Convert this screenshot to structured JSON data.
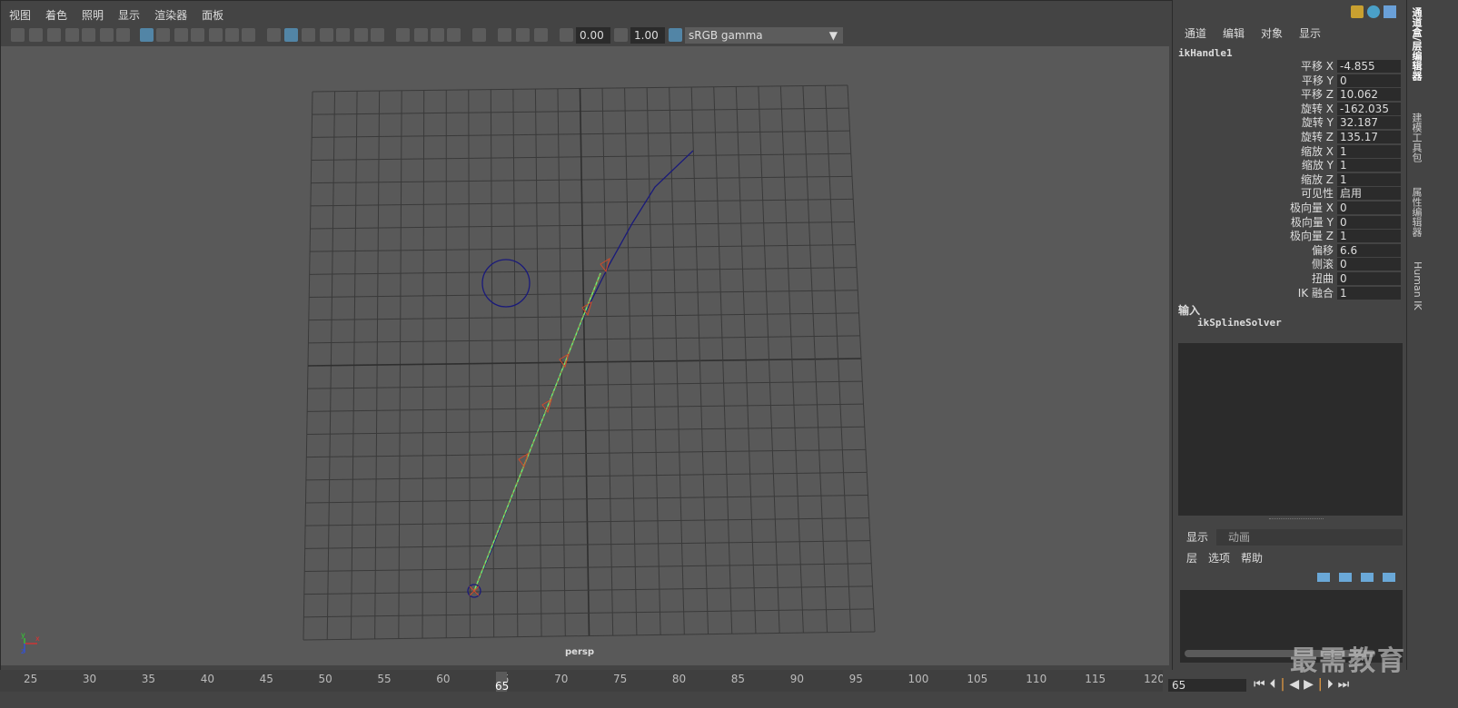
{
  "menubar": [
    "视图",
    "着色",
    "照明",
    "显示",
    "渲染器",
    "面板"
  ],
  "toolbar": {
    "exposure_value": "0.00",
    "gamma_value": "1.00",
    "colorspace": "sRGB gamma"
  },
  "viewport": {
    "camera_label": "persp",
    "axis_x": "x",
    "axis_y": "y",
    "axis_z": "z"
  },
  "channel_box": {
    "menu": [
      "通道",
      "编辑",
      "对象",
      "显示"
    ],
    "object_name": "ikHandle1",
    "attributes": [
      {
        "label": "平移 X",
        "value": "-4.855"
      },
      {
        "label": "平移 Y",
        "value": "0"
      },
      {
        "label": "平移 Z",
        "value": "10.062"
      },
      {
        "label": "旋转 X",
        "value": "-162.035"
      },
      {
        "label": "旋转 Y",
        "value": "32.187"
      },
      {
        "label": "旋转 Z",
        "value": "135.17"
      },
      {
        "label": "缩放 X",
        "value": "1"
      },
      {
        "label": "缩放 Y",
        "value": "1"
      },
      {
        "label": "缩放 Z",
        "value": "1"
      },
      {
        "label": "可见性",
        "value": "启用"
      },
      {
        "label": "极向量 X",
        "value": "0"
      },
      {
        "label": "极向量 Y",
        "value": "0"
      },
      {
        "label": "极向量 Z",
        "value": "1"
      },
      {
        "label": "偏移",
        "value": "6.6"
      },
      {
        "label": "侧滚",
        "value": "0"
      },
      {
        "label": "扭曲",
        "value": "0"
      },
      {
        "label": "IK 融合",
        "value": "1"
      }
    ],
    "inputs_header": "输入",
    "input_node": "ikSplineSolver"
  },
  "layer_editor": {
    "tabs": [
      "显示",
      "动画"
    ],
    "menu": [
      "层",
      "选项",
      "帮助"
    ]
  },
  "side_tabs": [
    "通道盒/层编辑器",
    "建模工具包",
    "属性编辑器",
    "Human IK"
  ],
  "timeline": {
    "ticks": [
      "25",
      "30",
      "35",
      "40",
      "45",
      "50",
      "55",
      "60",
      "65",
      "70",
      "75",
      "80",
      "85",
      "90",
      "95",
      "100",
      "105",
      "110",
      "115",
      "120"
    ],
    "current_frame": "65",
    "frame_field": "65"
  },
  "watermark": "最需教育",
  "colors": {
    "accent": "#5285a6",
    "viewport_bg": "#595959",
    "grid": "#3a3a3a",
    "curve": "#1a1a7a",
    "ik_joint": "#d04a2a",
    "ik_line": "#6ef06e"
  }
}
